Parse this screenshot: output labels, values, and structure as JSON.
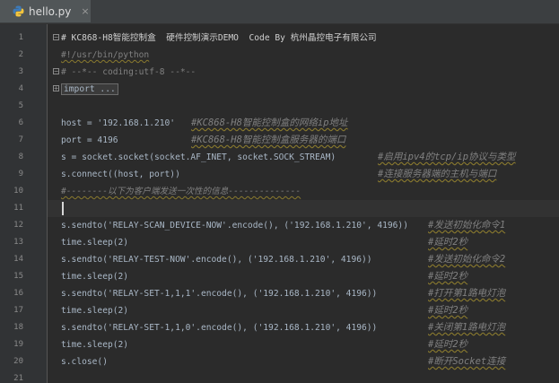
{
  "tab": {
    "label": "hello.py",
    "close": "×"
  },
  "lines": [
    {
      "n": "1",
      "code": "# KC868-H8智能控制盒  硬件控制演示DEMO  Code By 杭州晶控电子有限公司",
      "comment": ""
    },
    {
      "n": "2",
      "code": "#!/usr/bin/python",
      "comment": ""
    },
    {
      "n": "3",
      "code": "# --*-- coding:utf-8 --*--",
      "comment": ""
    },
    {
      "n": "4",
      "code": "import ...",
      "comment": ""
    },
    {
      "n": "5",
      "code": "",
      "comment": ""
    },
    {
      "n": "6",
      "code": "host = '192.168.1.210'",
      "comment": "#KC868-H8智能控制盒的网络ip地址"
    },
    {
      "n": "7",
      "code": "port = 4196",
      "comment": "#KC868-H8智能控制盒服务器的端口"
    },
    {
      "n": "8",
      "code": "s = socket.socket(socket.AF_INET, socket.SOCK_STREAM)",
      "comment": "#启用ipv4的tcp/ip协议与类型"
    },
    {
      "n": "9",
      "code": "s.connect((host, port))",
      "comment": "#连接服务器端的主机与端口"
    },
    {
      "n": "10",
      "code": "#--------以下为客户端发送一次性的信息--------------",
      "comment": ""
    },
    {
      "n": "11",
      "code": "",
      "comment": ""
    },
    {
      "n": "12",
      "code": "s.sendto('RELAY-SCAN_DEVICE-NOW'.encode(), ('192.168.1.210', 4196))",
      "comment": "#发送初始化命令1"
    },
    {
      "n": "13",
      "code": "time.sleep(2)",
      "comment": "#延时2秒"
    },
    {
      "n": "14",
      "code": "s.sendto('RELAY-TEST-NOW'.encode(), ('192.168.1.210', 4196))",
      "comment": "#发送初始化命令2"
    },
    {
      "n": "15",
      "code": "time.sleep(2)",
      "comment": "#延时2秒"
    },
    {
      "n": "16",
      "code": "s.sendto('RELAY-SET-1,1,1'.encode(), ('192.168.1.210', 4196))",
      "comment": "#打开第1路电灯泡"
    },
    {
      "n": "17",
      "code": "time.sleep(2)",
      "comment": "#延时2秒"
    },
    {
      "n": "18",
      "code": "s.sendto('RELAY-SET-1,1,0'.encode(), ('192.168.1.210', 4196))",
      "comment": "#关闭第1路电灯泡"
    },
    {
      "n": "19",
      "code": "time.sleep(2)",
      "comment": "#延时2秒"
    },
    {
      "n": "20",
      "code": "s.close()",
      "comment": "#断开Socket连接"
    },
    {
      "n": "21",
      "code": "",
      "comment": ""
    }
  ]
}
